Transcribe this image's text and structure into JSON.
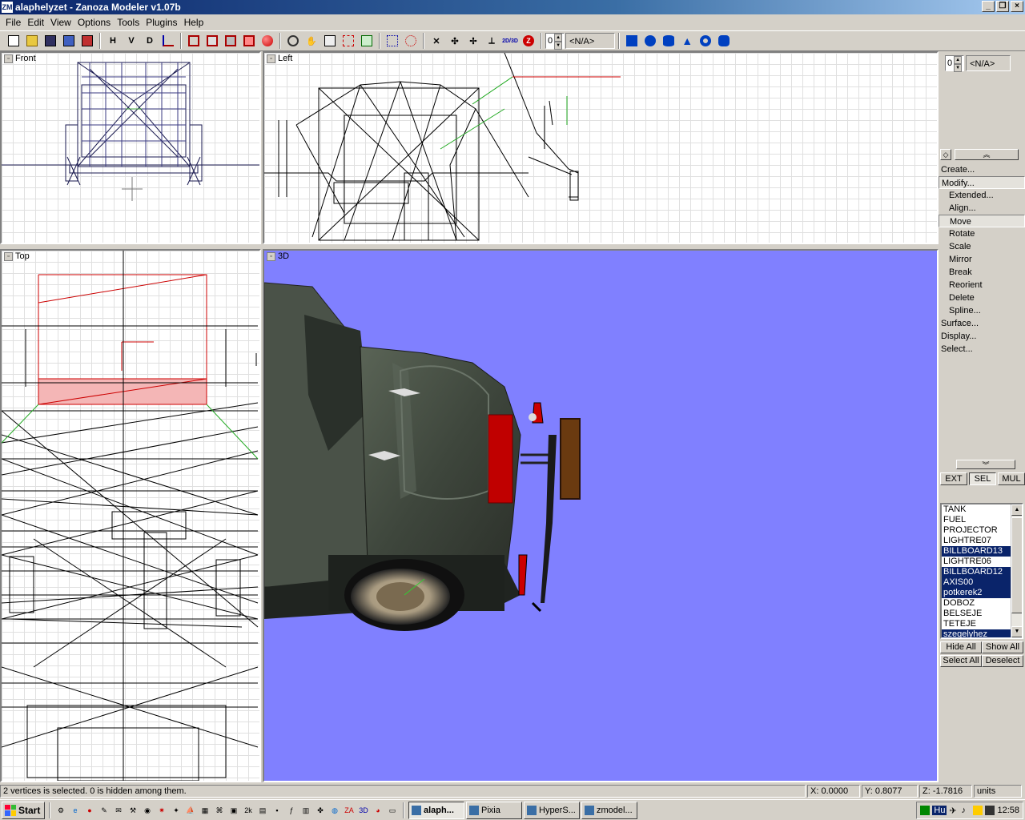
{
  "window": {
    "title": "alaphelyzet - Zanoza Modeler v1.07b"
  },
  "menu": [
    "File",
    "Edit",
    "View",
    "Options",
    "Tools",
    "Plugins",
    "Help"
  ],
  "toolbar": {
    "letters": [
      "H",
      "V",
      "D"
    ],
    "spin_value": "0",
    "na_value": "<N/A>",
    "labels_2d3d": "2D/3D",
    "z_label": "Z"
  },
  "viewports": {
    "front": "Front",
    "left": "Left",
    "top": "Top",
    "threed": "3D"
  },
  "sidepanel": {
    "spin_value": "0",
    "na_value": "<N/A>",
    "commands": [
      {
        "label": "Create...",
        "level": 0,
        "selected": false
      },
      {
        "label": "Modify...",
        "level": 0,
        "selected": true
      },
      {
        "label": "Extended...",
        "level": 1,
        "selected": false
      },
      {
        "label": "Align...",
        "level": 1,
        "selected": false
      },
      {
        "label": "Move",
        "level": 1,
        "selected": true
      },
      {
        "label": "Rotate",
        "level": 1,
        "selected": false
      },
      {
        "label": "Scale",
        "level": 1,
        "selected": false
      },
      {
        "label": "Mirror",
        "level": 1,
        "selected": false
      },
      {
        "label": "Break",
        "level": 1,
        "selected": false
      },
      {
        "label": "Reorient",
        "level": 1,
        "selected": false
      },
      {
        "label": "Delete",
        "level": 1,
        "selected": false
      },
      {
        "label": "Spline...",
        "level": 1,
        "selected": false
      },
      {
        "label": "Surface...",
        "level": 0,
        "selected": false
      },
      {
        "label": "Display...",
        "level": 0,
        "selected": false
      },
      {
        "label": "Select...",
        "level": 0,
        "selected": false
      }
    ],
    "modes": [
      {
        "label": "EXT",
        "active": false
      },
      {
        "label": "SEL",
        "active": true
      },
      {
        "label": "MUL",
        "active": false
      }
    ],
    "objects": [
      {
        "name": "TANK",
        "selected": false
      },
      {
        "name": "FUEL",
        "selected": false
      },
      {
        "name": "PROJECTOR",
        "selected": false
      },
      {
        "name": "LIGHTRE07",
        "selected": false
      },
      {
        "name": "BILLBOARD13",
        "selected": true
      },
      {
        "name": "LIGHTRE06",
        "selected": false
      },
      {
        "name": "BILLBOARD12",
        "selected": true
      },
      {
        "name": "AXIS00",
        "selected": true
      },
      {
        "name": "potkerek2",
        "selected": true
      },
      {
        "name": "DOBOZ",
        "selected": false
      },
      {
        "name": "BELSEJE",
        "selected": false
      },
      {
        "name": "TETEJE",
        "selected": false
      },
      {
        "name": "szegelyhez",
        "selected": true
      }
    ],
    "buttons": {
      "hide_all": "Hide All",
      "show_all": "Show All",
      "select_all": "Select All",
      "deselect": "Deselect"
    }
  },
  "status": {
    "message": "2 vertices is selected. 0 is hidden among them.",
    "x": "X: 0.0000",
    "y": "Y: 0.8077",
    "z": "Z: -1.7816",
    "units": "units"
  },
  "taskbar": {
    "start": "Start",
    "tasks": [
      {
        "label": "alaph...",
        "active": true
      },
      {
        "label": "Pixia",
        "active": false
      },
      {
        "label": "HyperS...",
        "active": false
      },
      {
        "label": "zmodel...",
        "active": false
      }
    ],
    "lang": "Hu",
    "clock": "12:58"
  },
  "colors": {
    "viewport_3d_bg": "#8080ff",
    "title_active": "#0a246a",
    "selection": "#0a246a"
  }
}
